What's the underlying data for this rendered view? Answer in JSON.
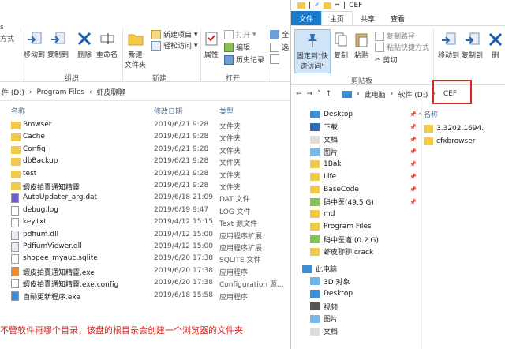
{
  "left_window": {
    "ribbon": {
      "copy_path_partial": "方式",
      "move_to": "移动到",
      "copy_to": "复制到",
      "delete": "删除",
      "rename": "重命名",
      "new_folder": "新建\n文件夹",
      "new_item": "新建项目",
      "easy_access": "轻松访问",
      "properties": "属性",
      "open": "打开",
      "edit": "编辑",
      "history": "历史记录",
      "select_all_partial": "全",
      "select_partial": "选",
      "group_organize": "组织",
      "group_new": "新建",
      "group_open": "打开"
    },
    "breadcrumb": [
      "件 (D:)",
      "Program Files",
      "虾皮聊聊"
    ],
    "columns": {
      "name": "名称",
      "date": "修改日期",
      "type": "类型"
    },
    "files": [
      {
        "name": "Browser",
        "date": "2019/6/21 9:28",
        "type": "文件夹",
        "icon": "folder"
      },
      {
        "name": "Cache",
        "date": "2019/6/21 9:28",
        "type": "文件夹",
        "icon": "folder"
      },
      {
        "name": "Config",
        "date": "2019/6/21 9:28",
        "type": "文件夹",
        "icon": "folder"
      },
      {
        "name": "dbBackup",
        "date": "2019/6/21 9:28",
        "type": "文件夹",
        "icon": "folder"
      },
      {
        "name": "test",
        "date": "2019/6/21 9:28",
        "type": "文件夹",
        "icon": "folder"
      },
      {
        "name": "蝦皮拍賣通知精靈",
        "date": "2019/6/21 9:28",
        "type": "文件夹",
        "icon": "folder"
      },
      {
        "name": "AutoUpdater_arg.dat",
        "date": "2019/6/18 21:09",
        "type": "DAT 文件",
        "icon": "dat"
      },
      {
        "name": "debug.log",
        "date": "2019/6/19 9:47",
        "type": "LOG 文件",
        "icon": "doc"
      },
      {
        "name": "key.txt",
        "date": "2019/4/12 15:15",
        "type": "Text 源文件",
        "icon": "doc"
      },
      {
        "name": "pdfium.dll",
        "date": "2019/4/12 15:00",
        "type": "应用程序扩展",
        "icon": "dll"
      },
      {
        "name": "PdfiumViewer.dll",
        "date": "2019/4/12 15:00",
        "type": "应用程序扩展",
        "icon": "dll"
      },
      {
        "name": "shopee_myauc.sqlite",
        "date": "2019/6/20 17:38",
        "type": "SQLITE 文件",
        "icon": "doc"
      },
      {
        "name": "蝦皮拍賣通知精靈.exe",
        "date": "2019/6/20 17:38",
        "type": "应用程序",
        "icon": "exe"
      },
      {
        "name": "蝦皮拍賣通知精靈.exe.config",
        "date": "2019/6/20 17:38",
        "type": "Configuration 源...",
        "icon": "doc"
      },
      {
        "name": "自動更新程序.exe",
        "date": "2019/6/18 15:58",
        "type": "应用程序",
        "icon": "exe2"
      }
    ]
  },
  "right_window": {
    "title": "CEF",
    "tabs": [
      "文件",
      "主页",
      "共享",
      "查看"
    ],
    "ribbon": {
      "pin": "固定到\"快\n速访问\"",
      "copy": "复制",
      "paste": "粘贴",
      "copy_path": "复制路径",
      "paste_shortcut": "粘贴快捷方式",
      "cut": "剪切",
      "clipboard": "剪贴板",
      "move_to": "移动到",
      "copy_to": "复制到",
      "delete_partial": "删"
    },
    "breadcrumb": [
      "此电脑",
      "软件 (D:)",
      "CEF"
    ],
    "nav": [
      {
        "label": "Desktop",
        "icon": "desktop",
        "pin": true,
        "indent": 0
      },
      {
        "label": "下载",
        "icon": "download",
        "pin": true,
        "indent": 0
      },
      {
        "label": "文档",
        "icon": "docs",
        "pin": true,
        "indent": 0
      },
      {
        "label": "图片",
        "icon": "pics",
        "pin": true,
        "indent": 0
      },
      {
        "label": "1Bak",
        "icon": "folder",
        "pin": true,
        "indent": 0
      },
      {
        "label": "Life",
        "icon": "folder",
        "pin": true,
        "indent": 0
      },
      {
        "label": "BaseCode",
        "icon": "folder",
        "pin": true,
        "indent": 0
      },
      {
        "label": "码中医(49.5 G)",
        "icon": "drive",
        "pin": true,
        "indent": 0
      },
      {
        "label": "md",
        "icon": "folder",
        "pin": false,
        "indent": 0
      },
      {
        "label": "Program Files",
        "icon": "folder",
        "pin": false,
        "indent": 0
      },
      {
        "label": "码中医道  (0.2 G)",
        "icon": "drive",
        "pin": false,
        "indent": 0
      },
      {
        "label": "虾皮聊聊.crack",
        "icon": "folder",
        "pin": false,
        "indent": 0
      },
      {
        "label": "此电脑",
        "icon": "pc",
        "pin": false,
        "indent": -1
      },
      {
        "label": "3D 对象",
        "icon": "obj3d",
        "pin": false,
        "indent": 0
      },
      {
        "label": "Desktop",
        "icon": "desktop",
        "pin": false,
        "indent": 0
      },
      {
        "label": "视频",
        "icon": "video",
        "pin": false,
        "indent": 0
      },
      {
        "label": "图片",
        "icon": "pics",
        "pin": false,
        "indent": 0
      },
      {
        "label": "文档",
        "icon": "docs",
        "pin": false,
        "indent": 0
      }
    ],
    "column_name": "名称",
    "files": [
      {
        "name": "3.3202.1694."
      },
      {
        "name": "cfxbrowser"
      }
    ]
  },
  "annotation": "不管软件再哪个目录，该盘的根目录会创建一个浏览器的文件夹",
  "colors": {
    "accent": "#1979ca",
    "folder": "#f3c94c",
    "highlight": "#d9231d"
  }
}
